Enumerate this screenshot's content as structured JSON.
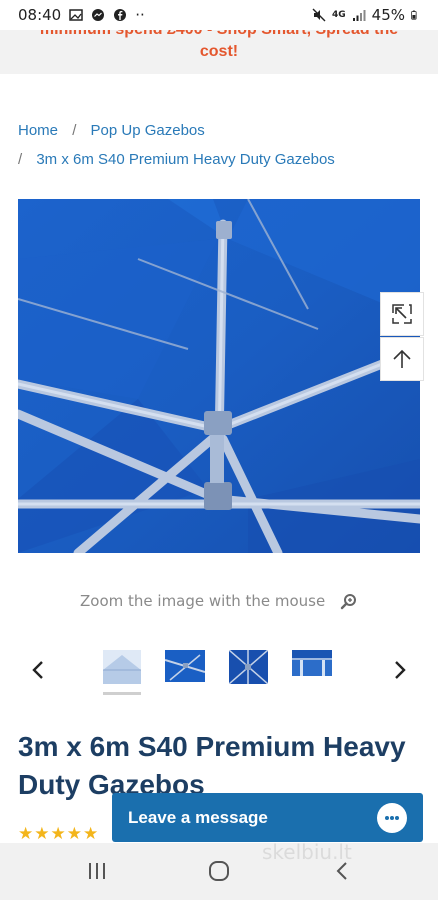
{
  "status_bar": {
    "time": "08:40",
    "dots": "··",
    "battery": "45%",
    "network": "4G"
  },
  "promo": {
    "line1": "minimum spend £400 - Shop Smart, Spread the",
    "line2": "cost!",
    "color": "#e4572e"
  },
  "breadcrumb": {
    "home": "Home",
    "category": "Pop Up Gazebos",
    "current": "3m x 6m S40 Premium Heavy Duty Gazebos",
    "separator": "/"
  },
  "gallery": {
    "main_image_icon": "gazebo-canopy-frame-photo",
    "side_buttons": [
      "expand-icon",
      "arrow-up-icon"
    ],
    "zoom_hint": "Zoom the image with the mouse",
    "thumbnail_count": 4
  },
  "product": {
    "title": "3m x 6m S40 Premium Heavy Duty Gazebos",
    "stars": "★★★★★"
  },
  "chat": {
    "label": "Leave a message"
  },
  "watermark": "skelbiu.lt",
  "colors": {
    "canopy_blue": "#1a5fc4",
    "title_navy": "#1d3e63",
    "link_blue": "#2a7ab8",
    "chat_blue": "#1a6fae",
    "star_gold": "#f3b51b"
  }
}
